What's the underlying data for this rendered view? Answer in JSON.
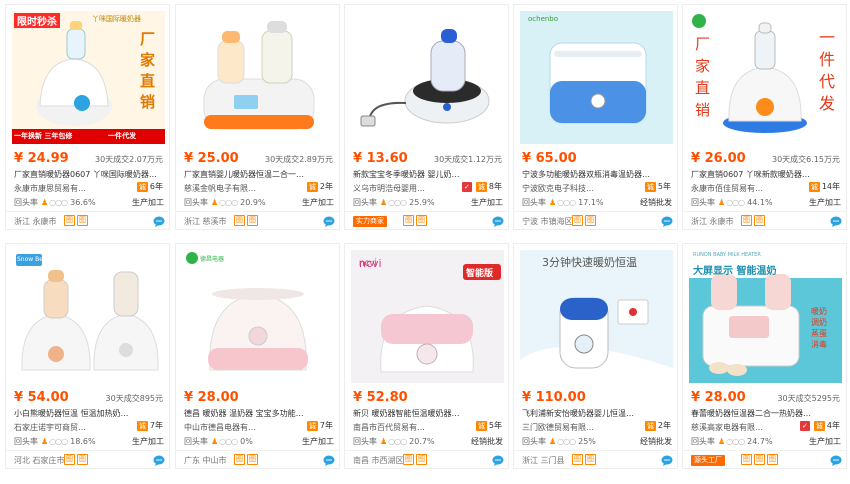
{
  "cards": [
    {
      "price": "¥ 24.99",
      "sold": "30天成交2.07万元",
      "title": "厂家直销暖奶器0607 丫咪国际暖奶器…",
      "shop": "永康市康思贸易有…",
      "years": "6年",
      "rate": "36.6%",
      "tag": "生产加工",
      "location": "浙江 永康市",
      "overlay": {
        "flash": "限时秒杀",
        "brand": "丫咪国际暖奶器",
        "side": "厂家直销",
        "bottom": "一年换新  三年包修",
        "bottom2": "一件代发"
      }
    },
    {
      "price": "¥ 25.00",
      "sold": "30天成交2.89万元",
      "title": "厂家直销婴儿暖奶器恒温二合一…",
      "shop": "慈溪金帆电子有限…",
      "years": "2年",
      "rate": "20.9%",
      "tag": "生产加工",
      "location": "浙江 慈溪市"
    },
    {
      "price": "¥ 13.60",
      "sold": "30天成交1.12万元",
      "title": "新款宝宝冬季暖奶器 婴儿奶…",
      "shop": "义乌市明浩母婴用…",
      "years": "8年",
      "rate": "25.9%",
      "tag": "生产加工",
      "location": "实力商家"
    },
    {
      "price": "¥ 65.00",
      "sold": "",
      "title": "宁波多功能暖奶器双瓶消毒温奶器…",
      "shop": "宁波欧克电子科技…",
      "years": "5年",
      "rate": "17.1%",
      "tag": "经销批发",
      "location": "宁波 市镇海区",
      "overlay": {
        "brand": "ochenbo"
      }
    },
    {
      "price": "¥ 26.00",
      "sold": "30天成交6.15万元",
      "title": "厂家直销0607 丫咪新款暖奶器…",
      "shop": "永康市佰佳贸易有…",
      "years": "14年",
      "rate": "44.1%",
      "tag": "生产加工",
      "location": "浙江 永康市",
      "overlay": {
        "side": "厂家直销",
        "side2": "一件代发"
      }
    },
    {
      "price": "¥ 54.00",
      "sold": "30天成交895元",
      "title": "小白熊暖奶器恒温 恒温加热奶…",
      "shop": "石家庄诺宇可商贸…",
      "years": "7年",
      "rate": "18.6%",
      "tag": "生产加工",
      "location": "河北 石家庄市",
      "overlay": {
        "brand": "Snow Bear"
      }
    },
    {
      "price": "¥ 28.00",
      "sold": "",
      "title": "德昌 暖奶器 温奶器 宝宝多功能…",
      "shop": "中山市德昌电器有…",
      "years": "7年",
      "rate": "0%",
      "tag": "生产加工",
      "location": "广东 中山市",
      "overlay": {
        "brand": "德昌电器"
      }
    },
    {
      "price": "¥ 52.80",
      "sold": "",
      "title": "新贝 暖奶器智能恒温暖奶器…",
      "shop": "南昌市百代贸易有…",
      "years": "5年",
      "rate": "20.7%",
      "tag": "经销批发",
      "location": "南昌 市西湖区",
      "overlay": {
        "brand": "ncvi",
        "badge": "智能版"
      }
    },
    {
      "price": "¥ 110.00",
      "sold": "",
      "title": "飞利浦新安怡暖奶器婴儿恒温…",
      "shop": "三门欧德贸易有限…",
      "years": "2年",
      "rate": "25%",
      "tag": "经销批发",
      "location": "浙江 三门县",
      "overlay": {
        "headline": "3分钟快速暖奶恒温"
      }
    },
    {
      "price": "¥ 28.00",
      "sold": "30天成交5295元",
      "title": "春蕾暖奶器恒温器二合一热奶器…",
      "shop": "慈溪高家电器有限…",
      "years": "4年",
      "rate": "24.7%",
      "tag": "生产加工",
      "location": "源头工厂",
      "overlay": {
        "brand": "RUNON BABY MILK HEATER",
        "headline": "大屏显示 智能温奶",
        "side": "暖奶 调奶 蒸蛋 消毒"
      }
    }
  ],
  "icon_square_label": "图"
}
